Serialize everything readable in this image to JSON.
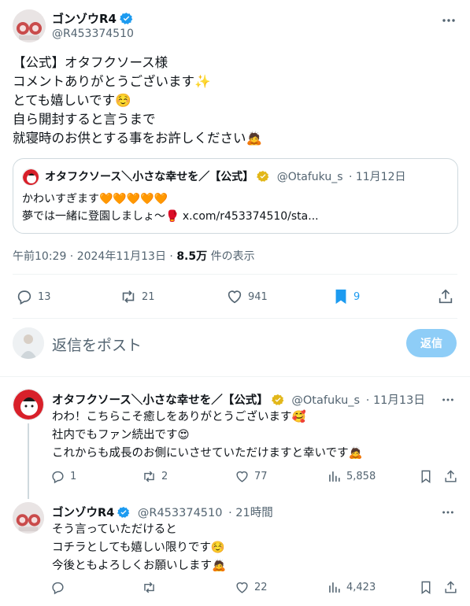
{
  "main_tweet": {
    "author_name": "ゴンゾウR4",
    "author_handle": "@R453374510",
    "lines": [
      "【公式】オタフクソース様",
      "コメントありがとうございます✨",
      "とても嬉しいです☺️",
      "自ら開封すると言うまで",
      "就寝時のお供とする事をお許しください🙇"
    ],
    "quote": {
      "author_name": "オタフクソース＼小さな幸せを／【公式】",
      "author_handle": "@Otafuku_s",
      "date": "· 11月12日",
      "line1": "かわいすぎます🧡🧡🧡🧡🧡",
      "line2": "夢では一緒に登園しましょ〜🥊",
      "link": "x.com/r453374510/sta..."
    },
    "timestamp": "午前10:29 · 2024年11月13日 · ",
    "views_count": "8.5万",
    "views_label": " 件の表示",
    "actions": {
      "replies": "13",
      "reposts": "21",
      "likes": "941",
      "bookmarks": "9"
    }
  },
  "composer": {
    "placeholder": "返信をポスト",
    "button": "返信"
  },
  "replies": [
    {
      "author_name": "オタフクソース＼小さな幸せを／【公式】",
      "author_handle": "@Otafuku_s",
      "time": "· 11月13日",
      "lines": [
        "わわ！こちらこそ癒しをありがとうございます🥰",
        "社内でもファン続出です😍",
        "これからも成長のお側にいさせていただけますと幸いです🙇"
      ],
      "actions": {
        "replies": "1",
        "reposts": "2",
        "likes": "77",
        "views": "5,858"
      }
    },
    {
      "author_name": "ゴンゾウR4",
      "author_handle": "@R453374510",
      "time": "· 21時間",
      "lines": [
        "そう言っていただけると",
        "コチラとしても嬉しい限りです☺️",
        "今後ともよろしくお願いします🙇"
      ],
      "actions": {
        "replies": "",
        "reposts": "",
        "likes": "22",
        "views": "4,423"
      }
    }
  ],
  "colors": {
    "accent": "#1d9bf0",
    "verified_blue": "#1d9bf0",
    "verified_gold": "#e2b719",
    "muted": "#536471"
  }
}
